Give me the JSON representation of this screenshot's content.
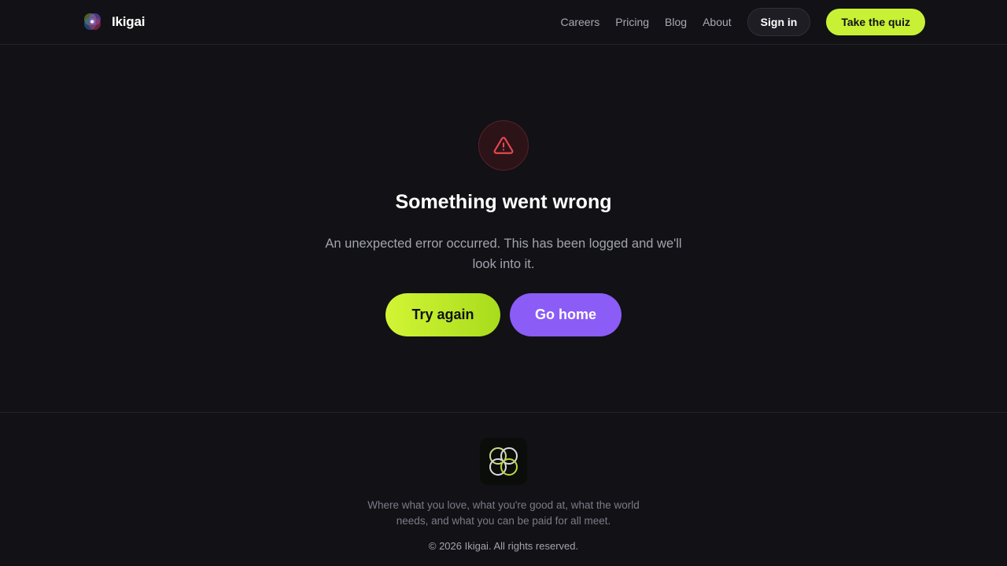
{
  "header": {
    "brand_name": "Ikigai",
    "nav": {
      "careers": "Careers",
      "pricing": "Pricing",
      "blog": "Blog",
      "about": "About"
    },
    "sign_in_label": "Sign in",
    "quiz_label": "Take the quiz"
  },
  "error": {
    "icon": "warning-triangle-icon",
    "title": "Something went wrong",
    "message": "An unexpected error occurred. This has been logged and we'll look into it.",
    "try_again_label": "Try again",
    "go_home_label": "Go home"
  },
  "footer": {
    "logo_icon": "ikigai-circles-logo",
    "tagline": "Where what you love, what you're good at, what the world needs, and what you can be paid for all meet.",
    "copyright": "© 2026 Ikigai. All rights reserved."
  },
  "colors": {
    "background": "#111116",
    "accent_lime": "#c8f135",
    "accent_purple": "#8b5cf6",
    "error_red": "#e5484d"
  }
}
